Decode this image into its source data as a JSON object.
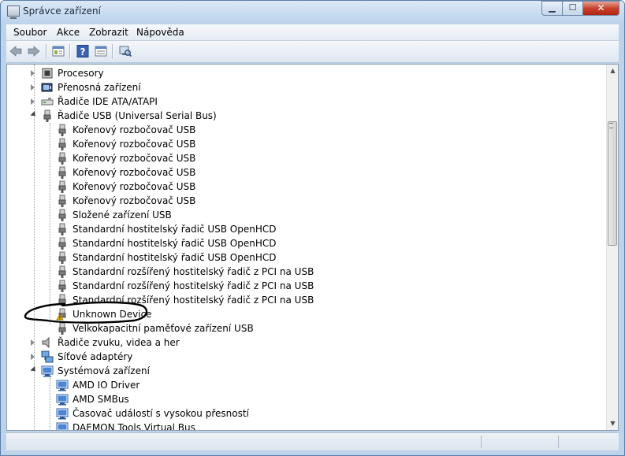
{
  "window": {
    "title": "Správce zařízení",
    "caption": {
      "minimize": "▁",
      "maximize": "☐",
      "close": "✕"
    }
  },
  "menu": [
    "Soubor",
    "Akce",
    "Zobrazit",
    "Nápověda"
  ],
  "toolbar_icons": [
    "back-arrow-icon",
    "forward-arrow-icon",
    "show-hide-console-tree-icon",
    "help-icon",
    "properties-icon",
    "scan-hardware-changes-icon"
  ],
  "tree": [
    {
      "label": "Procesory",
      "level": 0,
      "state": "closed",
      "icon": "processor-icon"
    },
    {
      "label": "Přenosná zařízení",
      "level": 0,
      "state": "closed",
      "icon": "portable-device-icon"
    },
    {
      "label": "Řadiče IDE ATA/ATAPI",
      "level": 0,
      "state": "closed",
      "icon": "ide-controller-icon"
    },
    {
      "label": "Řadiče USB (Universal Serial Bus)",
      "level": 0,
      "state": "open",
      "icon": "usb-plug-icon"
    },
    {
      "label": "Kořenový rozbočovač USB",
      "level": 1,
      "icon": "usb-plug-icon"
    },
    {
      "label": "Kořenový rozbočovač USB",
      "level": 1,
      "icon": "usb-plug-icon"
    },
    {
      "label": "Kořenový rozbočovač USB",
      "level": 1,
      "icon": "usb-plug-icon"
    },
    {
      "label": "Kořenový rozbočovač USB",
      "level": 1,
      "icon": "usb-plug-icon"
    },
    {
      "label": "Kořenový rozbočovač USB",
      "level": 1,
      "icon": "usb-plug-icon"
    },
    {
      "label": "Kořenový rozbočovač USB",
      "level": 1,
      "icon": "usb-plug-icon"
    },
    {
      "label": "Složené zařízení USB",
      "level": 1,
      "icon": "usb-plug-icon"
    },
    {
      "label": "Standardní hostitelský řadič  USB OpenHCD",
      "level": 1,
      "icon": "usb-plug-icon"
    },
    {
      "label": "Standardní hostitelský řadič  USB OpenHCD",
      "level": 1,
      "icon": "usb-plug-icon"
    },
    {
      "label": "Standardní hostitelský řadič  USB OpenHCD",
      "level": 1,
      "icon": "usb-plug-icon"
    },
    {
      "label": "Standardní rozšířený hostitelský řadič z PCI na USB",
      "level": 1,
      "icon": "usb-plug-icon"
    },
    {
      "label": "Standardní rozšířený hostitelský řadič z PCI na USB",
      "level": 1,
      "icon": "usb-plug-icon"
    },
    {
      "label": "Standardní rozšířený hostitelský řadič z PCI na USB",
      "level": 1,
      "icon": "usb-plug-icon"
    },
    {
      "label": "Unknown Device",
      "level": 1,
      "icon": "usb-warning-icon"
    },
    {
      "label": "Velkokapacitní paměťové zařízení USB",
      "level": 1,
      "icon": "usb-plug-icon"
    },
    {
      "label": "Řadiče zvuku, videa a her",
      "level": 0,
      "state": "closed",
      "icon": "speaker-icon"
    },
    {
      "label": "Síťové adaptéry",
      "level": 0,
      "state": "closed",
      "icon": "network-adapter-icon"
    },
    {
      "label": "Systémová zařízení",
      "level": 0,
      "state": "open",
      "icon": "system-device-icon"
    },
    {
      "label": "AMD IO Driver",
      "level": 1,
      "icon": "system-device-icon"
    },
    {
      "label": "AMD SMBus",
      "level": 1,
      "icon": "system-device-icon"
    },
    {
      "label": "Časovač událostí s vysokou přesností",
      "level": 1,
      "icon": "system-device-icon"
    },
    {
      "label": "DAEMON Tools Virtual Bus",
      "level": 1,
      "icon": "system-device-icon"
    }
  ],
  "scrollbar": {
    "up": "▲",
    "down": "▼"
  },
  "colors": {
    "annotation_stroke": "#000000",
    "warning": "#e8b400",
    "close_button": "#c7422e"
  }
}
